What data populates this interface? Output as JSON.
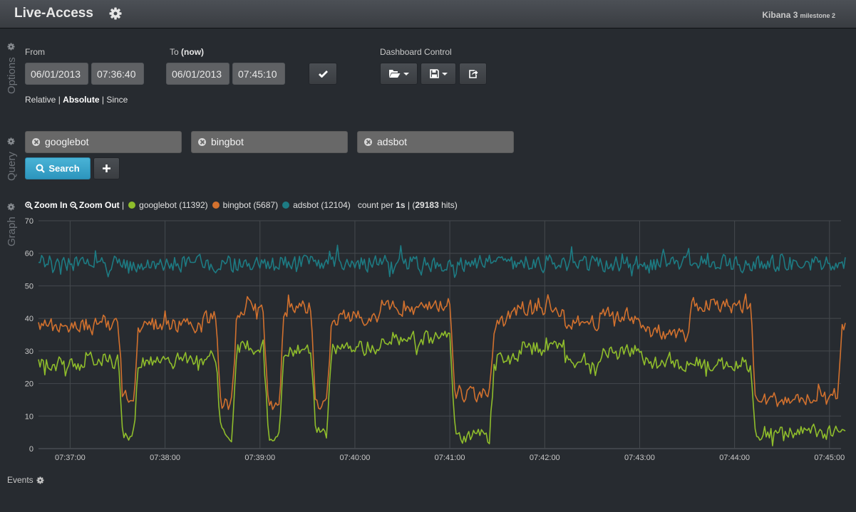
{
  "header": {
    "title": "Live-Access",
    "settings_icon": "gear-icon",
    "brand_name": "Kibana 3",
    "brand_version": "milestone 2"
  },
  "panels": {
    "options_label": "Options",
    "query_label": "Query",
    "graph_label": "Graph",
    "events_label": "Events"
  },
  "timepicker": {
    "from_label": "From",
    "to_label": "To",
    "to_suffix": "(now)",
    "from_date": "06/01/2013",
    "from_time": "07:36:40",
    "to_date": "06/01/2013",
    "to_time": "07:45:10",
    "apply_icon": "check-icon",
    "modes": {
      "relative": "Relative",
      "absolute": "Absolute",
      "since": "Since",
      "separator": "|"
    },
    "active_mode": "absolute"
  },
  "dashboard_control": {
    "label": "Dashboard Control",
    "buttons": [
      {
        "icon": "folder-open-icon",
        "dropdown": true
      },
      {
        "icon": "save-icon",
        "dropdown": true
      },
      {
        "icon": "share-icon",
        "dropdown": false
      }
    ]
  },
  "queries": [
    {
      "text": "googlebot"
    },
    {
      "text": "bingbot"
    },
    {
      "text": "adsbot"
    }
  ],
  "search_button": {
    "label": "Search",
    "icon": "search-icon"
  },
  "add_query_button": {
    "icon": "plus-icon"
  },
  "graph_legend": {
    "zoom_in": "Zoom In",
    "zoom_out": "Zoom Out",
    "separator": "|",
    "series": [
      {
        "label": "googlebot (11392)",
        "color": "#8fbd2b"
      },
      {
        "label": "bingbot (5687)",
        "color": "#d2712e"
      },
      {
        "label": "adsbot (12104)",
        "color": "#1d7b83"
      }
    ],
    "count_prefix": "count per",
    "interval": "1s",
    "hits_open": "(",
    "hits_count": "29183",
    "hits_suffix": "hits)"
  },
  "chart_data": {
    "type": "line",
    "title": "",
    "xlabel": "",
    "ylabel": "",
    "interval_seconds": 1,
    "x_start": "07:36:40",
    "x_end": "07:45:10",
    "ylim": [
      0,
      70
    ],
    "yticks": [
      0,
      10,
      20,
      30,
      40,
      50,
      60,
      70
    ],
    "xticks": [
      "07:37:00",
      "07:38:00",
      "07:39:00",
      "07:40:00",
      "07:41:00",
      "07:42:00",
      "07:43:00",
      "07:44:00",
      "07:45:00"
    ],
    "grid": true,
    "legend_placement": "top-left",
    "series": [
      {
        "name": "googlebot",
        "color": "#8fbd2b",
        "noise": 3,
        "segments": [
          [
            0,
            26
          ],
          [
            28,
            27
          ],
          [
            50,
            5
          ],
          [
            60,
            27
          ],
          [
            103,
            29
          ],
          [
            112,
            4
          ],
          [
            122,
            31
          ],
          [
            142,
            4
          ],
          [
            152,
            30
          ],
          [
            172,
            4
          ],
          [
            182,
            31
          ],
          [
            214,
            34
          ],
          [
            260,
            4
          ],
          [
            285,
            28
          ],
          [
            300,
            31
          ],
          [
            330,
            27
          ],
          [
            353,
            30
          ],
          [
            380,
            26
          ],
          [
            410,
            26
          ],
          [
            450,
            5
          ],
          [
            510,
            25
          ]
        ]
      },
      {
        "name": "bingbot",
        "color": "#d2712e",
        "noise": 3,
        "segments": [
          [
            0,
            38
          ],
          [
            28,
            38
          ],
          [
            50,
            16
          ],
          [
            60,
            38
          ],
          [
            103,
            40
          ],
          [
            112,
            14
          ],
          [
            122,
            43
          ],
          [
            142,
            14
          ],
          [
            152,
            43
          ],
          [
            172,
            14
          ],
          [
            182,
            40
          ],
          [
            214,
            44
          ],
          [
            260,
            17
          ],
          [
            285,
            40
          ],
          [
            300,
            43
          ],
          [
            330,
            39
          ],
          [
            353,
            41
          ],
          [
            380,
            35
          ],
          [
            410,
            44
          ],
          [
            450,
            15
          ],
          [
            505,
            38
          ],
          [
            510,
            39
          ]
        ]
      },
      {
        "name": "adsbot",
        "color": "#1d7b83",
        "noise": 3.2,
        "segments": [
          [
            0,
            57
          ],
          [
            510,
            57
          ]
        ]
      }
    ]
  }
}
